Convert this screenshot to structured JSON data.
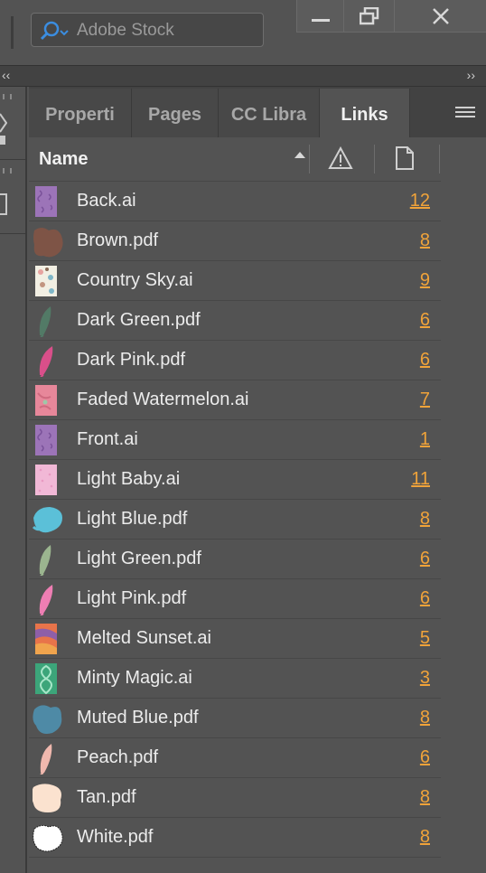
{
  "app": {
    "search_placeholder": "Adobe Stock"
  },
  "tabs": [
    {
      "label": "Properti",
      "active": false
    },
    {
      "label": "Pages",
      "active": false
    },
    {
      "label": "CC Libra",
      "active": false
    },
    {
      "label": "Links",
      "active": true
    }
  ],
  "columns": {
    "name": "Name",
    "status_icon": "warning-icon",
    "page_icon": "page-icon"
  },
  "links": [
    {
      "name": "Back.ai",
      "page": "12",
      "thumb": "purple-pattern"
    },
    {
      "name": "Brown.pdf",
      "page": "8",
      "thumb": "brown-blob"
    },
    {
      "name": "Country Sky.ai",
      "page": "9",
      "thumb": "country-sky"
    },
    {
      "name": "Dark Green.pdf",
      "page": "6",
      "thumb": "dark-green-feather"
    },
    {
      "name": "Dark Pink.pdf",
      "page": "6",
      "thumb": "dark-pink-feather"
    },
    {
      "name": "Faded Watermelon.ai",
      "page": "7",
      "thumb": "watermelon"
    },
    {
      "name": "Front.ai",
      "page": "1",
      "thumb": "purple-pattern"
    },
    {
      "name": "Light Baby.ai",
      "page": "11",
      "thumb": "light-baby"
    },
    {
      "name": "Light Blue.pdf",
      "page": "8",
      "thumb": "light-blue-blob"
    },
    {
      "name": "Light Green.pdf",
      "page": "6",
      "thumb": "light-green-feather"
    },
    {
      "name": "Light Pink.pdf",
      "page": "6",
      "thumb": "light-pink-feather"
    },
    {
      "name": "Melted Sunset.ai",
      "page": "5",
      "thumb": "melted-sunset"
    },
    {
      "name": "Minty Magic.ai",
      "page": "3",
      "thumb": "minty-magic"
    },
    {
      "name": "Muted Blue.pdf",
      "page": "8",
      "thumb": "muted-blue-blob"
    },
    {
      "name": "Peach.pdf",
      "page": "6",
      "thumb": "peach-feather"
    },
    {
      "name": "Tan.pdf",
      "page": "8",
      "thumb": "tan-blob"
    },
    {
      "name": "White.pdf",
      "page": "8",
      "thumb": "white-blob"
    }
  ],
  "colors": {
    "page_link": "#f0a33a",
    "panel_bg": "#535353",
    "accent_search": "#3b8de0"
  }
}
